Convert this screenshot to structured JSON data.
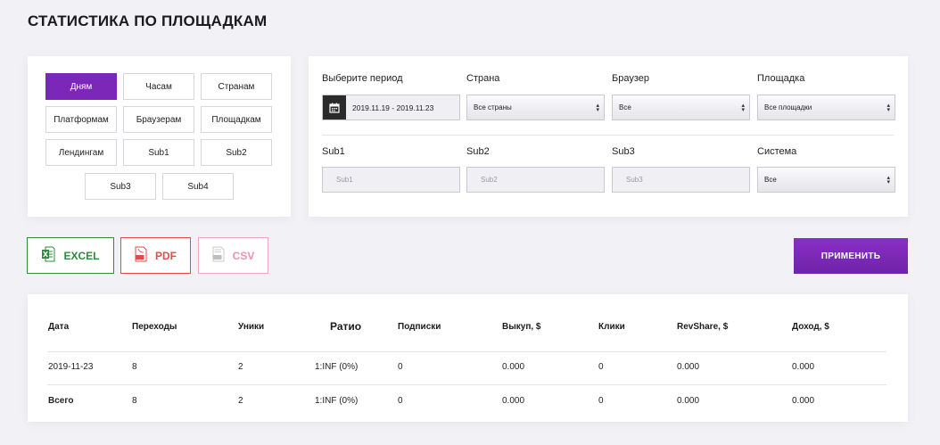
{
  "page": {
    "title": "СТАТИСТИКА ПО ПЛОЩАДКАМ"
  },
  "group_by": {
    "active": "Дням",
    "buttons": [
      "Дням",
      "Часам",
      "Странам",
      "Платформам",
      "Браузерам",
      "Площадкам",
      "Лендингам",
      "Sub1",
      "Sub2",
      "Sub3",
      "Sub4"
    ]
  },
  "filters": {
    "period_label": "Выберите период",
    "period_value": "2019.11.19 - 2019.11.23",
    "country_label": "Страна",
    "country_value": "Все страны",
    "browser_label": "Браузер",
    "browser_value": "Все",
    "site_label": "Площадка",
    "site_value": "Все площадки",
    "sub1_label": "Sub1",
    "sub1_placeholder": "Sub1",
    "sub2_label": "Sub2",
    "sub2_placeholder": "Sub2",
    "sub3_label": "Sub3",
    "sub3_placeholder": "Sub3",
    "system_label": "Система",
    "system_value": "Все"
  },
  "export": {
    "excel": "EXCEL",
    "pdf": "PDF",
    "csv": "CSV"
  },
  "apply_label": "ПРИМЕНИТЬ",
  "table": {
    "headers": [
      "Дата",
      "Переходы",
      "Уники",
      "Ратио",
      "Подписки",
      "Выкуп, $",
      "Клики",
      "RevShare, $",
      "Доход, $"
    ],
    "rows": [
      [
        "2019-11-23",
        "8",
        "2",
        "1:INF (0%)",
        "0",
        "0.000",
        "0",
        "0.000",
        "0.000"
      ]
    ],
    "total": [
      "Всего",
      "8",
      "2",
      "1:INF (0%)",
      "0",
      "0.000",
      "0",
      "0.000",
      "0.000"
    ]
  },
  "colors": {
    "accent": "#7c27b8",
    "excel": "#2f8a3e",
    "pdf": "#e34b4b",
    "csv": "#ef8fb0"
  }
}
